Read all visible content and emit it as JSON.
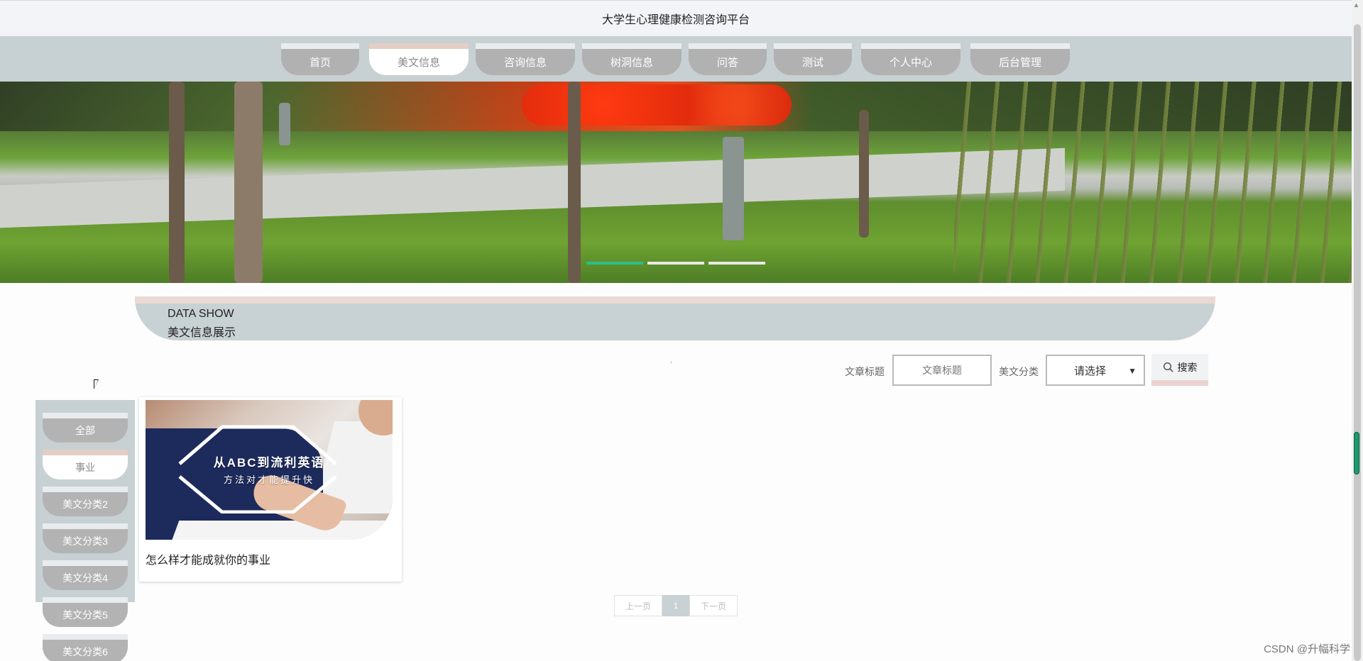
{
  "header": {
    "title": "大学生心理健康检测咨询平台"
  },
  "nav": {
    "items": [
      {
        "label": "首页",
        "active": false
      },
      {
        "label": "美文信息",
        "active": true
      },
      {
        "label": "咨询信息",
        "active": false
      },
      {
        "label": "树洞信息",
        "active": false
      },
      {
        "label": "问答",
        "active": false
      },
      {
        "label": "测试",
        "active": false
      },
      {
        "label": "个人中心",
        "active": false
      },
      {
        "label": "后台管理",
        "active": false
      }
    ]
  },
  "banner": {
    "slides": 3,
    "active_slide": 1
  },
  "section": {
    "title_en": "DATA SHOW",
    "title_cn": "美文信息展示"
  },
  "search": {
    "title_label": "文章标题",
    "title_placeholder": "文章标题",
    "category_label": "美文分类",
    "category_selected": "请选择",
    "button_label": "搜索"
  },
  "categories": {
    "items": [
      {
        "label": "全部",
        "active": false
      },
      {
        "label": "事业",
        "active": true
      },
      {
        "label": "美文分类2",
        "active": false
      },
      {
        "label": "美文分类3",
        "active": false
      },
      {
        "label": "美文分类4",
        "active": false
      },
      {
        "label": "美文分类5",
        "active": false
      },
      {
        "label": "美文分类6",
        "active": false
      }
    ]
  },
  "articles": [
    {
      "title": "怎么样才能成就你的事业",
      "image_text_main": "从ABC到流利英语",
      "image_text_sub": "方法对才能提升快"
    }
  ],
  "pagination": {
    "prev": "上一页",
    "current": "1",
    "next": "下一页"
  },
  "watermark": "CSDN @升幅科学",
  "colors": {
    "accent_green": "#2bbf8a",
    "nav_bg": "#c7d0d3",
    "tab_active_border": "#e3cdc4"
  }
}
